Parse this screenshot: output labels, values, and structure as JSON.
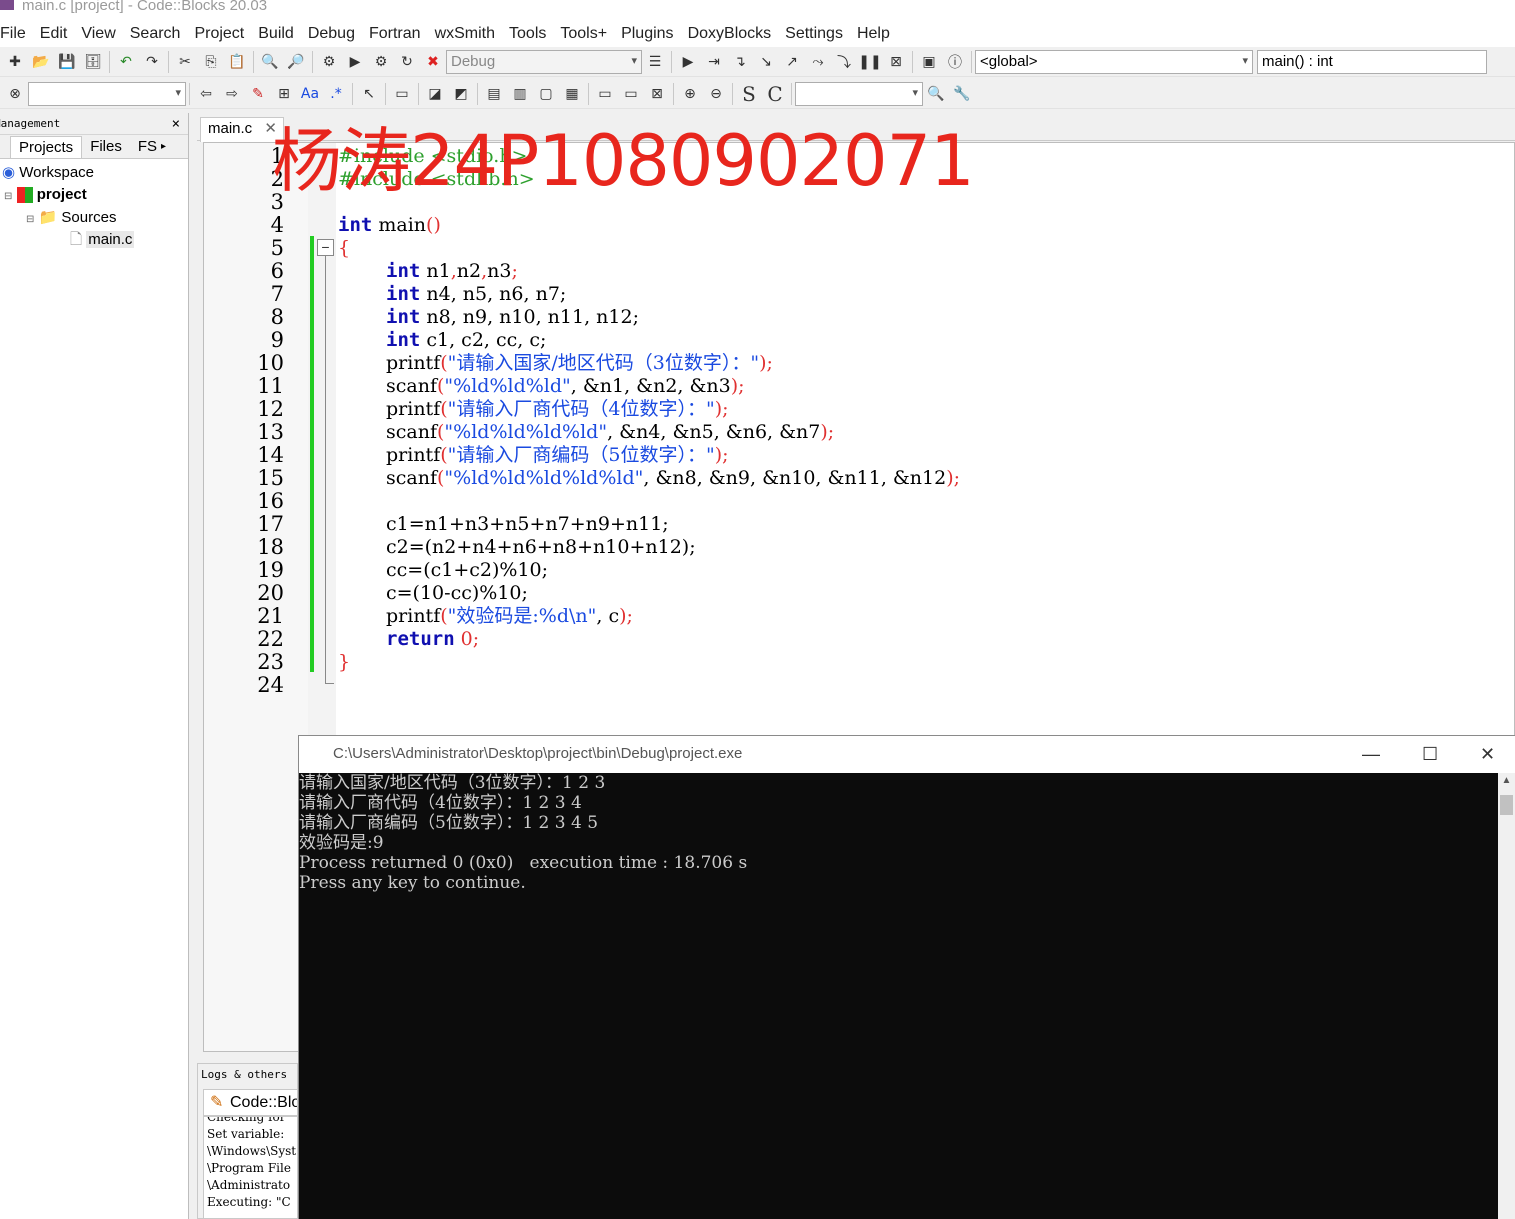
{
  "window": {
    "title": "main.c [project] - Code::Blocks 20.03"
  },
  "menu": [
    "File",
    "Edit",
    "View",
    "Search",
    "Project",
    "Build",
    "Debug",
    "Fortran",
    "wxSmith",
    "Tools",
    "Tools+",
    "Plugins",
    "DoxyBlocks",
    "Settings",
    "Help"
  ],
  "toolbar": {
    "build_target": "Debug",
    "scope": "<global>",
    "function": "main() : int"
  },
  "management": {
    "header": "Management",
    "tabs": [
      "Projects",
      "Files",
      "FS"
    ],
    "tree": {
      "workspace": "Workspace",
      "project": "project",
      "folder": "Sources",
      "file": "main.c"
    }
  },
  "editor": {
    "tab": "main.c",
    "watermark": "杨涛24P1080902071",
    "line_numbers": [
      "1",
      "2",
      "3",
      "4",
      "5",
      "6",
      "7",
      "8",
      "9",
      "10",
      "11",
      "12",
      "13",
      "14",
      "15",
      "16",
      "17",
      "18",
      "19",
      "20",
      "21",
      "22",
      "23",
      "24"
    ]
  },
  "code": {
    "l1": "#include <stdio.h>",
    "l2": "#include <stdlib.h>",
    "l4_kw": "int",
    "l4_rest": " main",
    "l4_p": "()",
    "l5": "{",
    "l6_kw": "int",
    "l6_rest": " n1",
    "l6_b": ",",
    "l6_c": "n2",
    "l6_d": ",",
    "l6_e": "n3",
    "l6_f": ";",
    "l7_kw": "int",
    "l7": " n4, n5, n6, n7;",
    "l8_kw": "int",
    "l8": " n8, n9, n10, n11, n12;",
    "l9_kw": "int",
    "l9": " c1, c2, cc, c;",
    "l10_fn": "printf",
    "l10_open": "(",
    "l10_str": "\"请输入国家/地区代码（3位数字）：\"",
    "l10_close": ");",
    "l11_fn": "scanf",
    "l11_open": "(",
    "l11_str": "\"%ld%ld%ld\"",
    "l11_args": ", &n1, &n2, &n3",
    "l11_close": ");",
    "l12_fn": "printf",
    "l12_open": "(",
    "l12_str": "\"请输入厂商代码（4位数字）：\"",
    "l12_close": ");",
    "l13_fn": "scanf",
    "l13_open": "(",
    "l13_str": "\"%ld%ld%ld%ld\"",
    "l13_args": ", &n4, &n5, &n6, &n7",
    "l13_close": ");",
    "l14_fn": "printf",
    "l14_open": "(",
    "l14_str": "\"请输入厂商编码（5位数字）：\"",
    "l14_close": ");",
    "l15_fn": "scanf",
    "l15_open": "(",
    "l15_str": "\"%ld%ld%ld%ld%ld\"",
    "l15_args": ", &n8, &n9, &n10, &n11, &n12",
    "l15_close": ");",
    "l17": "c1=n1+n3+n5+n7+n9+n11;",
    "l18": "c2=(n2+n4+n6+n8+n10+n12);",
    "l19": "cc=(c1+c2)%10;",
    "l20": "c=(10-cc)%10;",
    "l21_fn": "printf",
    "l21_open": "(",
    "l21_str": "\"效验码是:%d\\n\"",
    "l21_args": ", c",
    "l21_close": ");",
    "l22_kw": "return",
    "l22_num": " 0",
    "l22_end": ";",
    "l23": "}"
  },
  "logs": {
    "header": "Logs & others",
    "tab": "Code::Blocks",
    "lines": [
      "Checking for",
      "Set variable:",
      "\\Windows\\Syst",
      "\\Program File",
      "\\Administrato",
      "Executing: \"C"
    ]
  },
  "console": {
    "title": "C:\\Users\\Administrator\\Desktop\\project\\bin\\Debug\\project.exe",
    "lines": [
      "请输入国家/地区代码（3位数字）：1 2 3",
      "请输入厂商代码（4位数字）：1 2 3 4",
      "请输入厂商编码（5位数字）：1 2 3 4 5",
      "效验码是:9",
      "",
      "Process returned 0 (0x0)   execution time : 18.706 s",
      "Press any key to continue."
    ]
  }
}
